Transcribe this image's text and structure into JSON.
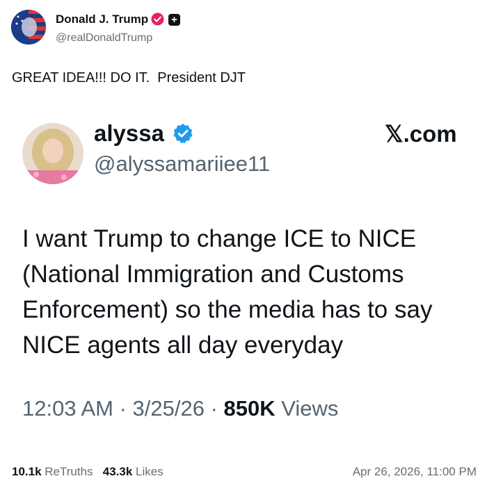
{
  "post": {
    "author_name": "Donald J. Trump",
    "author_handle": "@realDonaldTrump",
    "text": "GREAT IDEA!!! DO IT.  President DJT",
    "retruths_count": "10.1k",
    "retruths_label": "ReTruths",
    "likes_count": "43.3k",
    "likes_label": "Likes",
    "date": "Apr 26, 2026, 11:00 PM"
  },
  "embedded_tweet": {
    "name": "alyssa",
    "handle": "@alyssamariiee11",
    "site": "𝕏.com",
    "body": "I want Trump to change ICE to NICE (National Immigration and Customs Enforcement) so the media has to say NICE agents all day everyday",
    "time": "12:03 AM",
    "date": "3/25/26",
    "views_count": "850K",
    "views_label": "Views"
  },
  "icons": {
    "author_avatar": "flag-portrait-avatar",
    "verified_badge": "pink-verified-badge-icon",
    "plus_badge": "plus-badge-icon",
    "tweet_verified": "blue-verified-check-icon"
  },
  "colors": {
    "verified_pink": "#e0245e",
    "verified_blue": "#1d9bf0",
    "muted": "#6b6b75"
  }
}
